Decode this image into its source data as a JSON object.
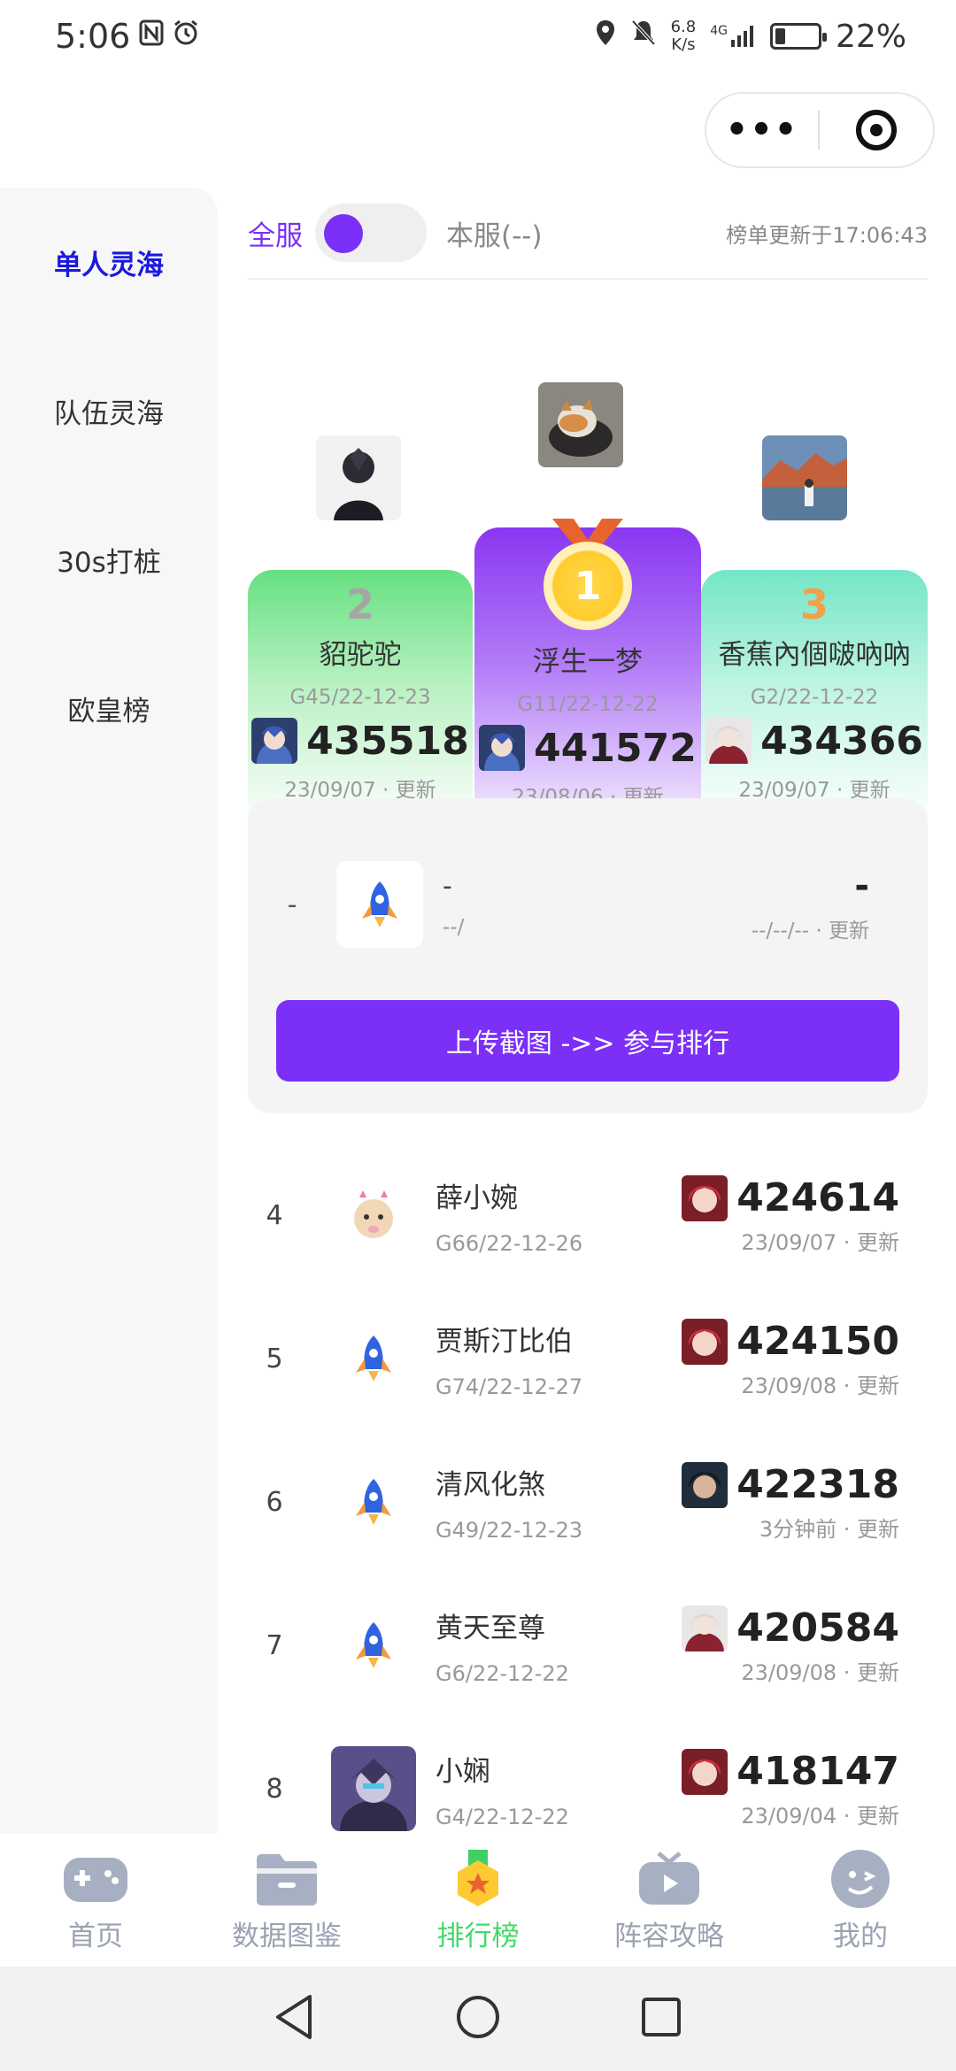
{
  "status_bar": {
    "time": "5:06",
    "net_speed_value": "6.8",
    "net_speed_unit": "K/s",
    "network_type": "4G",
    "battery_percent": "22%",
    "battery_level": 0.22
  },
  "toolbar": {
    "all_server_label": "全服",
    "local_server_label": "本服(--)",
    "updated_text": "榜单更新于17:06:43"
  },
  "sidebar": {
    "items": [
      {
        "label": "单人灵海"
      },
      {
        "label": "队伍灵海"
      },
      {
        "label": "30s打桩"
      },
      {
        "label": "欧皇榜"
      }
    ]
  },
  "podium": {
    "first": {
      "rank": "1",
      "name": "浮生一梦",
      "server": "G11/22-12-22",
      "score": "441572",
      "updated": "23/08/06 · 更新"
    },
    "second": {
      "rank": "2",
      "name": "貂驼驼",
      "server": "G45/22-12-23",
      "score": "435518",
      "updated": "23/09/07 · 更新"
    },
    "third": {
      "rank": "3",
      "name": "香蕉內個啵吶吶",
      "server": "G2/22-12-22",
      "score": "434366",
      "updated": "23/09/07 · 更新"
    }
  },
  "my_card": {
    "rank": "-",
    "name": "-",
    "server": "--/",
    "score": "-",
    "updated": "--/--/-- · 更新",
    "upload_label": "上传截图 ->> 参与排行"
  },
  "ranking_list": [
    {
      "rank": "4",
      "name": "薛小婉",
      "server": "G66/22-12-26",
      "score": "424614",
      "updated": "23/09/07 · 更新"
    },
    {
      "rank": "5",
      "name": "贾斯汀比伯",
      "server": "G74/22-12-27",
      "score": "424150",
      "updated": "23/09/08 · 更新"
    },
    {
      "rank": "6",
      "name": "清风化煞",
      "server": "G49/22-12-23",
      "score": "422318",
      "updated": "3分钟前 · 更新"
    },
    {
      "rank": "7",
      "name": "黄天至尊",
      "server": "G6/22-12-22",
      "score": "420584",
      "updated": "23/09/08 · 更新"
    },
    {
      "rank": "8",
      "name": "小娴",
      "server": "G4/22-12-22",
      "score": "418147",
      "updated": "23/09/04 · 更新"
    }
  ],
  "bottom_nav": {
    "items": [
      {
        "label": "首页",
        "icon": "gamepad-icon"
      },
      {
        "label": "数据图鉴",
        "icon": "folder-icon"
      },
      {
        "label": "排行榜",
        "icon": "medal-icon"
      },
      {
        "label": "阵容攻略",
        "icon": "tv-icon"
      },
      {
        "label": "我的",
        "icon": "face-icon"
      }
    ]
  },
  "colors": {
    "accent": "#7b2ff7",
    "active_nav": "#43d96a",
    "sidebar_active": "#1a1adf"
  }
}
